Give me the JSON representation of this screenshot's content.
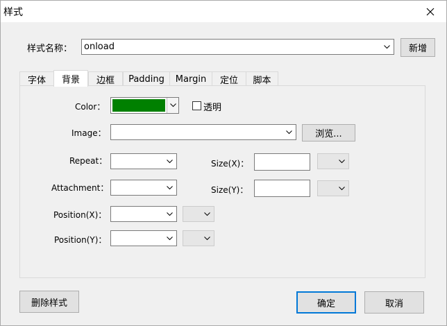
{
  "window": {
    "title": "样式"
  },
  "style_name": {
    "label": "样式名称：",
    "value": "onload",
    "add_button": "新增"
  },
  "tabs": [
    {
      "label": "字体",
      "active": false
    },
    {
      "label": "背景",
      "active": true
    },
    {
      "label": "边框",
      "active": false
    },
    {
      "label": "Padding",
      "active": false
    },
    {
      "label": "Margin",
      "active": false
    },
    {
      "label": "定位",
      "active": false
    },
    {
      "label": "脚本",
      "active": false
    }
  ],
  "background": {
    "color_label": "Color：",
    "color_value": "#008000",
    "transparent_label": "透明",
    "transparent_checked": false,
    "image_label": "Image：",
    "image_value": "",
    "browse_button": "浏览...",
    "repeat_label": "Repeat：",
    "repeat_value": "",
    "attachment_label": "Attachment：",
    "attachment_value": "",
    "position_x_label": "Position(X)：",
    "position_x_value": "",
    "position_y_label": "Position(Y)：",
    "position_y_value": "",
    "size_x_label": "Size(X)：",
    "size_x_value": "",
    "size_y_label": "Size(Y)：",
    "size_y_value": ""
  },
  "footer": {
    "delete_button": "删除样式",
    "ok_button": "确定",
    "cancel_button": "取消"
  },
  "icons": {
    "close": "close-icon",
    "dropdown": "chevron-down-icon"
  }
}
